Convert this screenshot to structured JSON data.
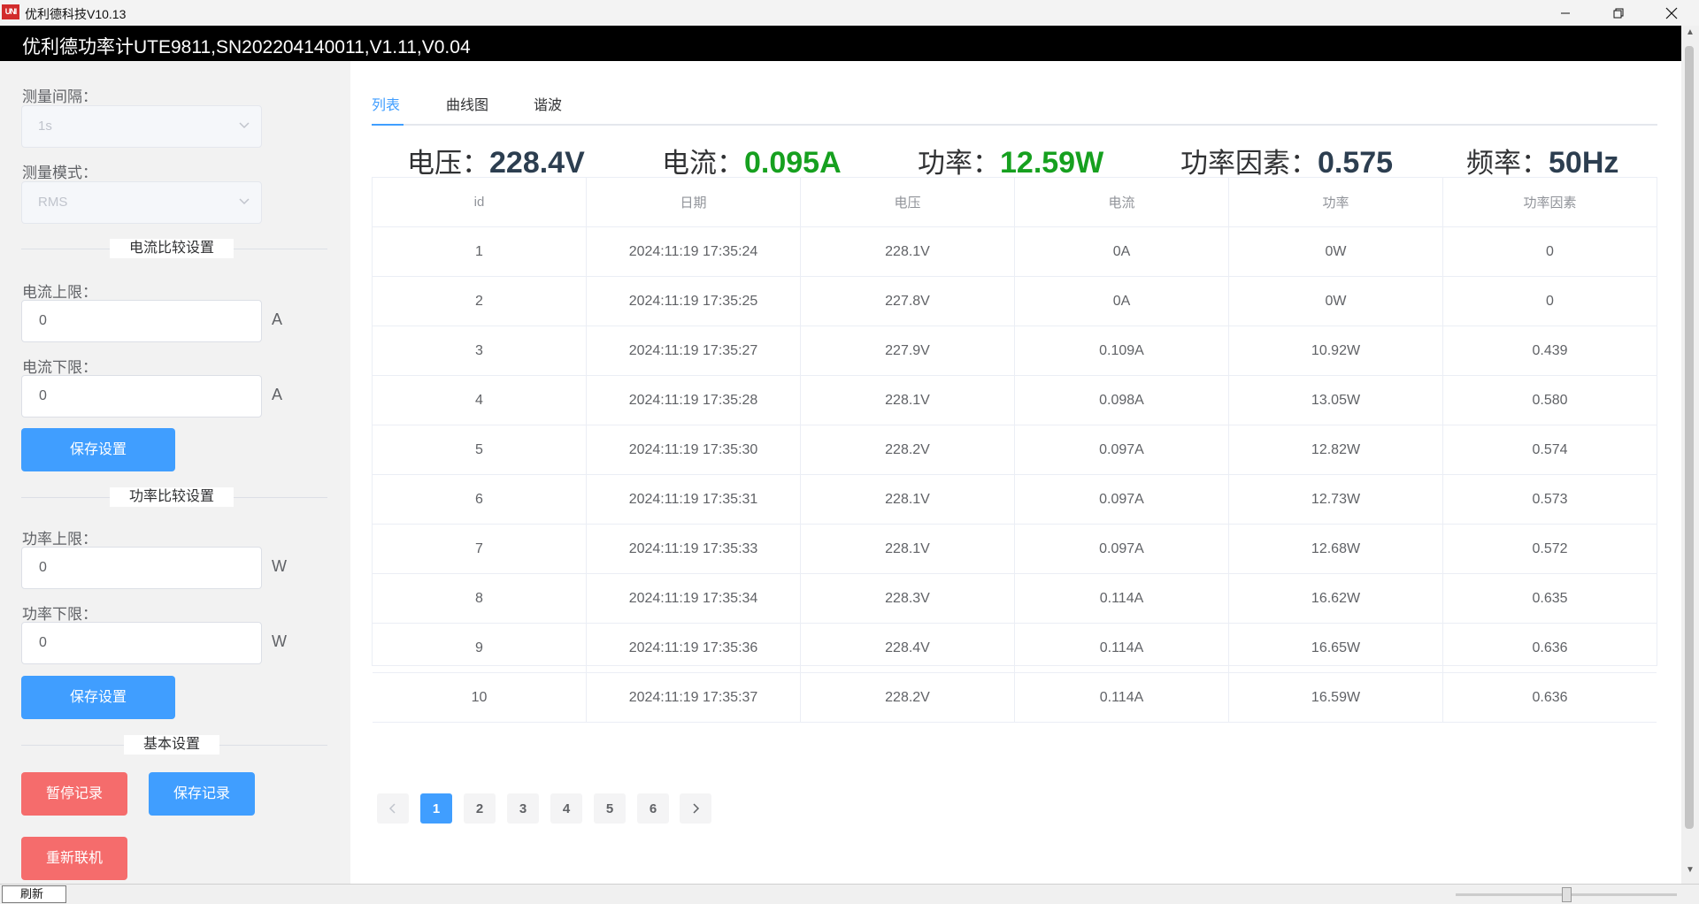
{
  "window": {
    "title": "优利德科技V10.13",
    "logo_text": "UNI-T"
  },
  "header": {
    "title": "优利德功率计UTE9811,SN202204140011,V1.11,V0.04"
  },
  "sidebar": {
    "interval_label": "测量间隔：",
    "interval_value": "1s",
    "mode_label": "测量模式：",
    "mode_value": "RMS",
    "current_section": "电流比较设置",
    "current_upper_label": "电流上限：",
    "current_upper_value": "0",
    "current_lower_label": "电流下限：",
    "current_lower_value": "0",
    "current_unit": "A",
    "save_settings_1": "保存设置",
    "power_section": "功率比较设置",
    "power_upper_label": "功率上限：",
    "power_upper_value": "0",
    "power_lower_label": "功率下限：",
    "power_lower_value": "0",
    "power_unit": "W",
    "save_settings_2": "保存设置",
    "basic_section": "基本设置",
    "pause_record": "暂停记录",
    "save_record": "保存记录",
    "reconnect": "重新联机"
  },
  "tabs": [
    {
      "label": "列表",
      "active": true
    },
    {
      "label": "曲线图",
      "active": false
    },
    {
      "label": "谐波",
      "active": false
    }
  ],
  "metrics": [
    {
      "label": "电压：",
      "value": "228.4V",
      "color": "#2c3e50"
    },
    {
      "label": "电流：",
      "value": "0.095A",
      "color": "#16a01f"
    },
    {
      "label": "功率：",
      "value": "12.59W",
      "color": "#16a01f"
    },
    {
      "label": "功率因素：",
      "value": "0.575",
      "color": "#2c3e50"
    },
    {
      "label": "频率：",
      "value": "50Hz",
      "color": "#2c3e50"
    }
  ],
  "table": {
    "columns": [
      "id",
      "日期",
      "电压",
      "电流",
      "功率",
      "功率因素"
    ],
    "rows": [
      [
        "1",
        "2024:11:19 17:35:24",
        "228.1V",
        "0A",
        "0W",
        "0"
      ],
      [
        "2",
        "2024:11:19 17:35:25",
        "227.8V",
        "0A",
        "0W",
        "0"
      ],
      [
        "3",
        "2024:11:19 17:35:27",
        "227.9V",
        "0.109A",
        "10.92W",
        "0.439"
      ],
      [
        "4",
        "2024:11:19 17:35:28",
        "228.1V",
        "0.098A",
        "13.05W",
        "0.580"
      ],
      [
        "5",
        "2024:11:19 17:35:30",
        "228.2V",
        "0.097A",
        "12.82W",
        "0.574"
      ],
      [
        "6",
        "2024:11:19 17:35:31",
        "228.1V",
        "0.097A",
        "12.73W",
        "0.573"
      ],
      [
        "7",
        "2024:11:19 17:35:33",
        "228.1V",
        "0.097A",
        "12.68W",
        "0.572"
      ],
      [
        "8",
        "2024:11:19 17:35:34",
        "228.3V",
        "0.114A",
        "16.62W",
        "0.635"
      ],
      [
        "9",
        "2024:11:19 17:35:36",
        "228.4V",
        "0.114A",
        "16.65W",
        "0.636"
      ],
      [
        "10",
        "2024:11:19 17:35:37",
        "228.2V",
        "0.114A",
        "16.59W",
        "0.636"
      ]
    ]
  },
  "pagination": {
    "pages": [
      "1",
      "2",
      "3",
      "4",
      "5",
      "6"
    ],
    "current": "1"
  },
  "statusbar": {
    "refresh": "刷新"
  },
  "colors": {
    "accent": "#409eff",
    "danger": "#f56c6c",
    "value_green": "#16a01f"
  }
}
